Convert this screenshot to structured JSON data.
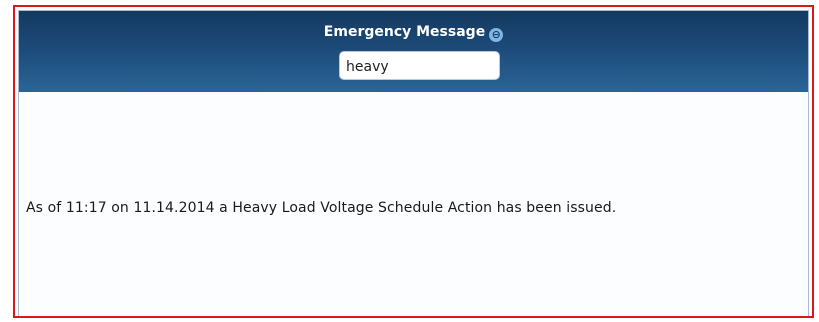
{
  "header": {
    "title": "Emergency Message",
    "info_icon": "⊖"
  },
  "search": {
    "value": "heavy"
  },
  "message": {
    "text": "As of 11:17 on 11.14.2014 a Heavy Load Voltage Schedule Action has been issued."
  },
  "colors": {
    "frame_border": "#e0151b",
    "header_top": "#15395f",
    "header_bottom": "#2a6597",
    "panel_border": "#9fbcd6"
  }
}
